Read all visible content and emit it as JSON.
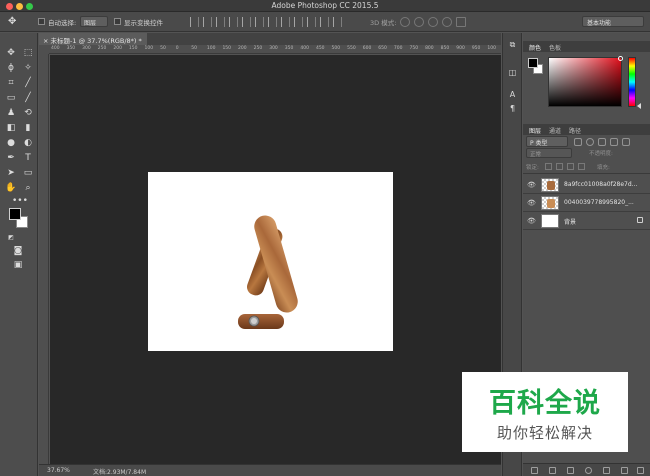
{
  "app": {
    "title": "Adobe Photoshop CC 2015.5"
  },
  "options_bar": {
    "auto_select_label": "自动选择:",
    "auto_select_value": "图层",
    "show_transform_label": "显示变换控件",
    "mode_3d_label": "3D 模式:",
    "workspace": "基本功能"
  },
  "document": {
    "tab_label": "未标题-1 @ 37.7%(RGB/8*) *",
    "ruler_ticks": [
      "400",
      "350",
      "300",
      "250",
      "200",
      "150",
      "100",
      "50",
      "0",
      "50",
      "100",
      "150",
      "200",
      "250",
      "300",
      "350",
      "400",
      "450",
      "500",
      "550",
      "600",
      "650",
      "700",
      "750",
      "800",
      "850",
      "900",
      "950",
      "100"
    ]
  },
  "status": {
    "zoom": "37.67%",
    "doc_info": "文档:2.93M/7.84M"
  },
  "color_panel": {
    "tabs": [
      "颜色",
      "色板"
    ],
    "foreground": "#000000",
    "background": "#ffffff",
    "hue_color": "#e0101c"
  },
  "layers_panel": {
    "tabs": [
      "图层",
      "通道",
      "路径"
    ],
    "filter_kind": "P 类型",
    "blend_mode": "正常",
    "opacity_label": "不透明度:",
    "lock_label": "锁定:",
    "fill_label": "填充:",
    "layers": [
      {
        "name": "8a9fcc01008a0f28e7d...",
        "selected": false
      },
      {
        "name": "0040039778995820_...",
        "selected": false
      },
      {
        "name": "背景",
        "selected": false
      }
    ]
  },
  "watermark": {
    "title": "百科全说",
    "subtitle": "助你轻松解决"
  }
}
